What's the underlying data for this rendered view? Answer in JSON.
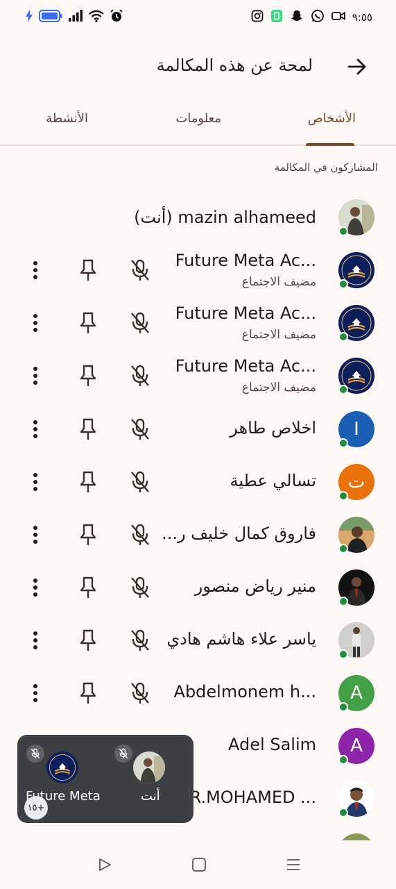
{
  "status_bar": {
    "time": "٩:٥٥"
  },
  "header": {
    "title": "لمحة عن هذه المكالمة"
  },
  "tabs": [
    {
      "label": "الأشخاص",
      "active": true
    },
    {
      "label": "معلومات",
      "active": false
    },
    {
      "label": "الأنشطة",
      "active": false
    }
  ],
  "section_label": "المشاركون في المكالمة",
  "participants": [
    {
      "name": "mazin alhameed (أنت)",
      "role": "",
      "avatar": "photo"
    },
    {
      "name": "Future Meta Ac...",
      "role": "مضيف الاجتماع",
      "avatar": "logo"
    },
    {
      "name": "Future Meta Ac...",
      "role": "مضيف الاجتماع",
      "avatar": "logo"
    },
    {
      "name": "Future Meta Ac...",
      "role": "مضيف الاجتماع",
      "avatar": "logo"
    },
    {
      "name": "اخلاص طاهر",
      "initial": "I",
      "avatar_color": "#1a5fb4"
    },
    {
      "name": "تسالي عطية",
      "initial": "ت",
      "avatar_color": "#e8710a"
    },
    {
      "name": "فاروق كمال خليف ر...",
      "avatar": "photo"
    },
    {
      "name": "منير رياض منصور",
      "avatar": "photo"
    },
    {
      "name": "ياسر علاء هاشم هادي",
      "avatar": "photo"
    },
    {
      "name": "Abdelmonem h...",
      "initial": "A",
      "avatar_color": "#43a047"
    },
    {
      "name": "Adel Salim",
      "initial": "A",
      "avatar_color": "#8e24aa"
    },
    {
      "name": "DR.MOHAMED ...",
      "avatar": "photo"
    }
  ],
  "floating_view": {
    "tiles": [
      {
        "name": "Future Meta"
      },
      {
        "name": "أنت"
      }
    ],
    "more_count": "١٥+"
  },
  "colors": {
    "accent": "#7a4a28",
    "online": "#1e8e3e",
    "background": "#fdf8f6"
  }
}
